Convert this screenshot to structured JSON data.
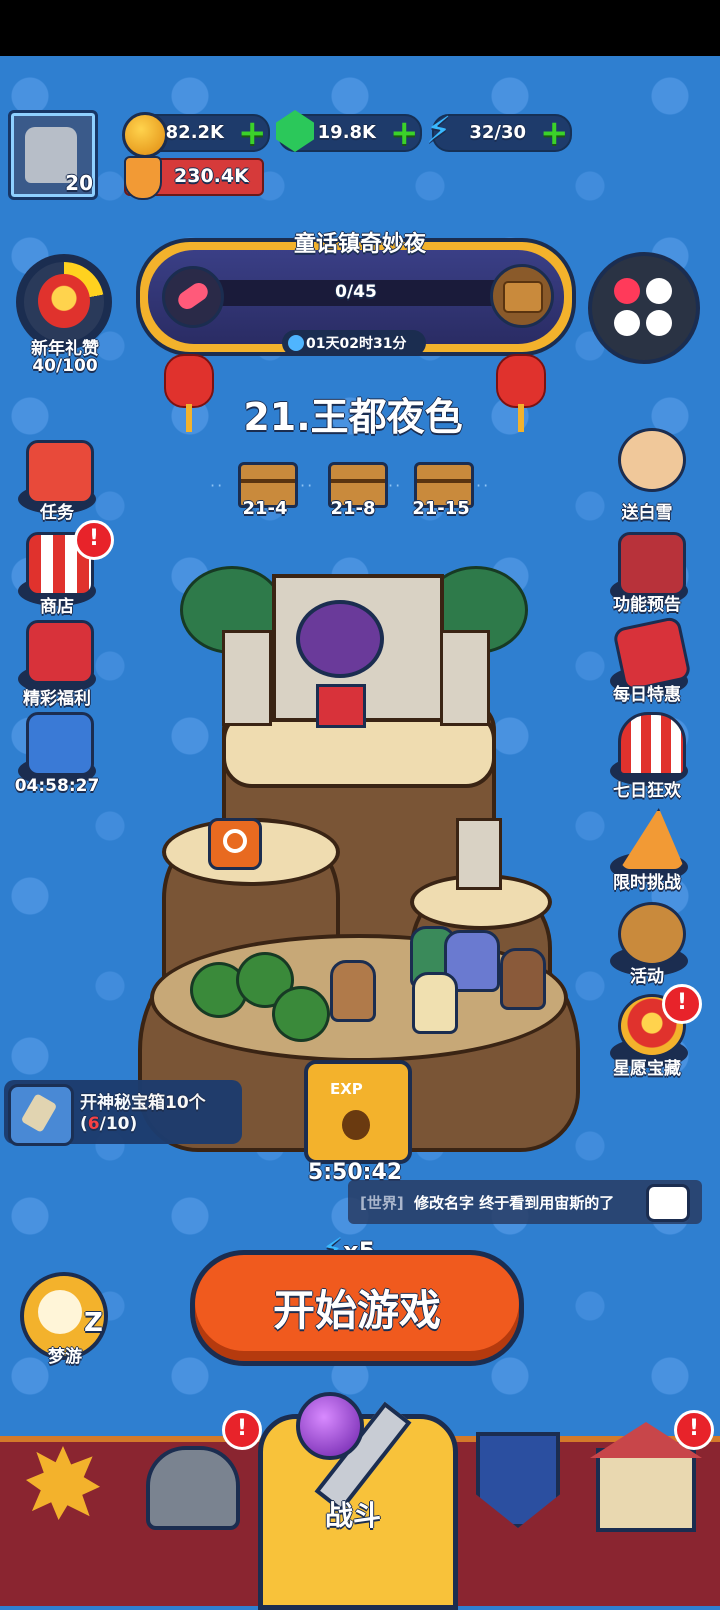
{
  "currencies": {
    "gold": "82.2K",
    "gems": "19.8K",
    "energy": "32/30",
    "plus": "+"
  },
  "player": {
    "level": "20",
    "power": "230.4K"
  },
  "event": {
    "title": "童话镇奇妙夜",
    "progress": "0/45",
    "timer": "01天02时31分"
  },
  "left_menu": {
    "new_year": {
      "label": "新年礼赞",
      "progress": "40/100"
    },
    "tasks": "任务",
    "shop": "商店",
    "welfare": "精彩福利",
    "gift_timer": "04:58:27"
  },
  "chapter": {
    "title": "21.王都夜色",
    "stages": [
      "21-4",
      "21-8",
      "21-15"
    ],
    "dots": "··"
  },
  "right_menu": {
    "snow_white": "送白雪",
    "preview": "功能预告",
    "daily_deal": "每日特惠",
    "seven_day": "七日狂欢",
    "limited": "限时挑战",
    "activity": "活动",
    "wish": "星愿宝藏"
  },
  "quest": {
    "title": "开神秘宝箱10个",
    "progress_open": "(",
    "progress_done": "6",
    "progress_rest": "/10)"
  },
  "exp_chest": {
    "label": "EXP",
    "timer": "5:50:42"
  },
  "chat": {
    "channel": "[世界]",
    "message": "修改名字 终于看到用宙斯的了"
  },
  "start": {
    "label": "开始游戏",
    "cost": "x5"
  },
  "dream": {
    "label": "梦游",
    "z": "Z"
  },
  "nav": {
    "battle": "战斗"
  },
  "badge": "!",
  "colors": {
    "accent": "#f05a1e",
    "bg": "#2f7fd0",
    "nav": "#8a2530"
  }
}
